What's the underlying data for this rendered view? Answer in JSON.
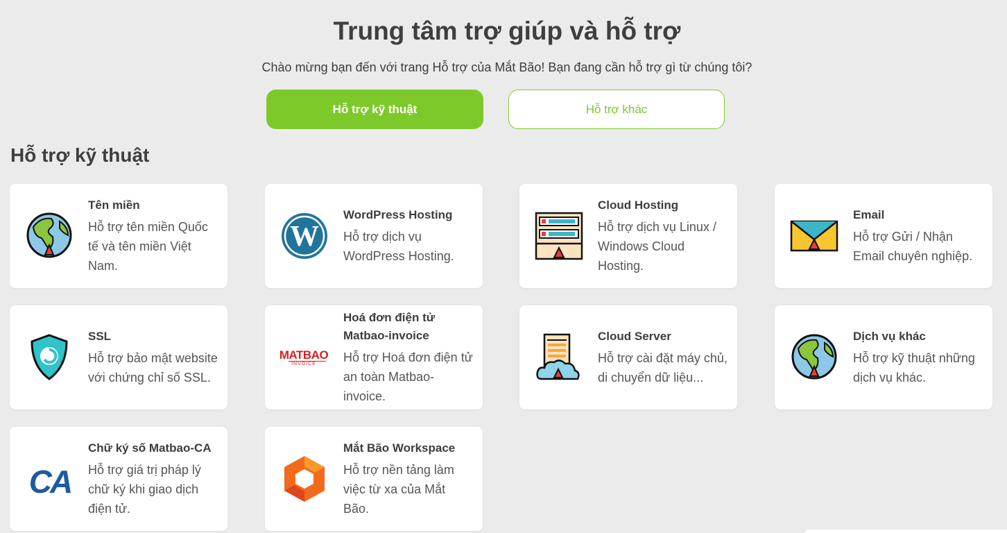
{
  "header": {
    "title": "Trung tâm trợ giúp và hỗ trợ",
    "subtitle": "Chào mừng bạn đến với trang Hỗ trợ của Mắt Bão! Bạn đang cần hỗ trợ gì từ chúng tôi?"
  },
  "tabs": [
    {
      "label": "Hỗ trợ kỹ thuật",
      "active": true
    },
    {
      "label": "Hỗ trợ khác",
      "active": false
    }
  ],
  "section": {
    "title": "Hỗ trợ kỹ thuật"
  },
  "colors": {
    "accent": "#7dc92a",
    "background": "#ebebeb"
  },
  "cards": [
    {
      "title": "Tên miền",
      "desc": "Hỗ trợ tên miền Quốc tế và tên miền Việt Nam.",
      "icon": "globe-icon"
    },
    {
      "title": "WordPress Hosting",
      "desc": "Hỗ trợ dịch vụ WordPress Hosting.",
      "icon": "wordpress-icon"
    },
    {
      "title": "Cloud Hosting",
      "desc": "Hỗ trợ dịch vụ Linux / Windows Cloud Hosting.",
      "icon": "server-rack-icon"
    },
    {
      "title": "Email",
      "desc": "Hỗ trợ Gửi / Nhận Email chuyên nghiệp.",
      "icon": "envelope-icon"
    },
    {
      "title": "SSL",
      "desc": "Hỗ trợ bảo mật website với chứng chỉ số SSL.",
      "icon": "shield-icon"
    },
    {
      "title": "Hoá đơn điện tử Matbao-invoice",
      "desc": "Hỗ trợ Hoá đơn điện tử an toàn Matbao-invoice.",
      "icon": "matbao-invoice-logo",
      "logo_text": "MATBAO",
      "logo_sub": "INVOICE"
    },
    {
      "title": "Cloud Server",
      "desc": "Hỗ trợ cài đặt máy chủ, di chuyển dữ liệu...",
      "icon": "cloud-server-icon"
    },
    {
      "title": "Dịch vụ khác",
      "desc": "Hỗ trợ kỹ thuật những dịch vụ khác.",
      "icon": "globe-icon"
    },
    {
      "title": "Chữ ký số Matbao-CA",
      "desc": "Hỗ trợ giá trị pháp lý chữ ký khi giao dịch điện tử.",
      "icon": "ca-logo",
      "logo_text": "CA"
    },
    {
      "title": "Mắt Bão Workspace",
      "desc": "Hỗ trợ nền tảng làm việc từ xa của Mắt Bão.",
      "icon": "workspace-hexagon-icon"
    }
  ]
}
